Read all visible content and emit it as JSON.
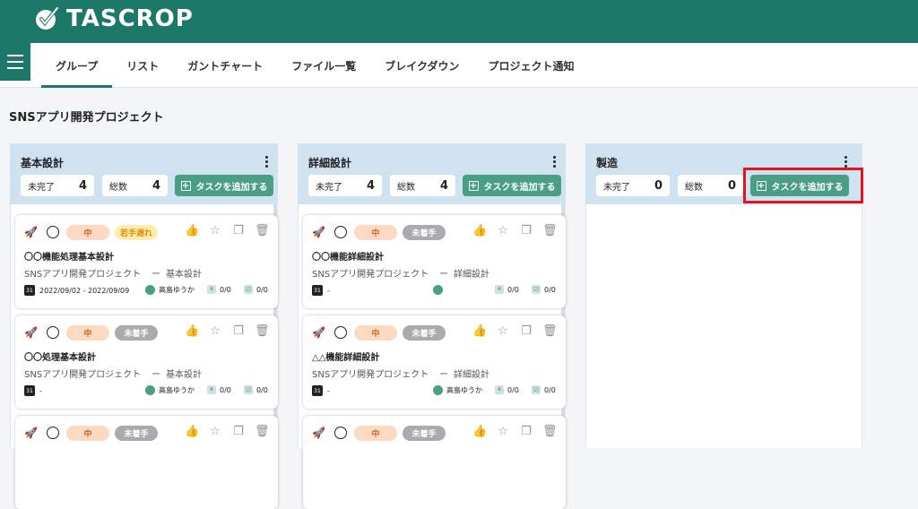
{
  "app": {
    "name": "TASCROP"
  },
  "tabs": [
    {
      "label": "グループ"
    },
    {
      "label": "リスト"
    },
    {
      "label": "ガントチャート"
    },
    {
      "label": "ファイル一覧"
    },
    {
      "label": "ブレイクダウン"
    },
    {
      "label": "プロジェクト通知"
    }
  ],
  "page": {
    "title": "SNSアプリ開発プロジェクト"
  },
  "colors": {
    "brand": "#1c7868",
    "accent": "#4a9e86",
    "column_header": "#cfe2f0",
    "highlight": "#e5131d"
  },
  "columns": [
    {
      "title": "基本設計",
      "incomplete_label": "未完了",
      "incomplete_count": "4",
      "total_label": "総数",
      "total_count": "4",
      "add_label": "タスクを追加する",
      "cards": [
        {
          "priority": "中",
          "status": "若手遅れ",
          "name": "〇〇機能処理基本設計",
          "project": "SNSアプリ開発プロジェクト",
          "dash": "ー",
          "parent": "基本設計",
          "dates": "2022/09/02 - 2022/09/09",
          "user": "高島ゆうか",
          "subtasks": "0/0",
          "checks": "0/0"
        },
        {
          "priority": "中",
          "status": "未着手",
          "name": "〇〇処理基本設計",
          "project": "SNSアプリ開発プロジェクト",
          "dash": "ー",
          "parent": "基本設計",
          "dates": "-",
          "user": "高島ゆうか",
          "subtasks": "0/0",
          "checks": "0/0"
        },
        {
          "priority": "中",
          "status": "未着手"
        }
      ]
    },
    {
      "title": "詳細設計",
      "incomplete_label": "未完了",
      "incomplete_count": "4",
      "total_label": "総数",
      "total_count": "4",
      "add_label": "タスクを追加する",
      "cards": [
        {
          "priority": "中",
          "status": "未着手",
          "name": "〇〇機能詳細設計",
          "project": "SNSアプリ開発プロジェクト",
          "dash": "ー",
          "parent": "詳細設計",
          "dates": "-",
          "user": "",
          "subtasks": "0/0",
          "checks": "0/0"
        },
        {
          "priority": "中",
          "status": "未着手",
          "name": "△△機能詳細設計",
          "project": "SNSアプリ開発プロジェクト",
          "dash": "ー",
          "parent": "詳細設計",
          "dates": "-",
          "user": "高島ゆうか",
          "subtasks": "0/0",
          "checks": "0/0"
        },
        {
          "priority": "中",
          "status": "未着手"
        }
      ]
    },
    {
      "title": "製造",
      "incomplete_label": "未完了",
      "incomplete_count": "0",
      "total_label": "総数",
      "total_count": "0",
      "add_label": "タスクを追加する",
      "cards": []
    }
  ]
}
